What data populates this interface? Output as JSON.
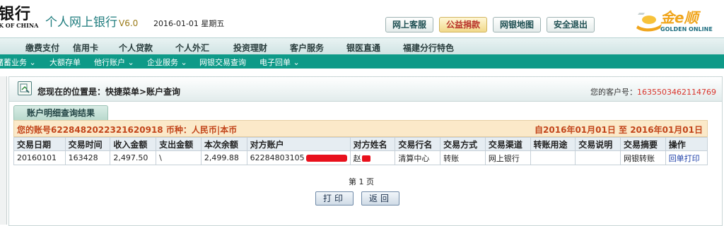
{
  "header": {
    "bank_name": "银行",
    "bank_sub": "K OF CHINA",
    "site_title": "个人网上银行",
    "version": "V6.0",
    "date": "2016-01-01 星期五",
    "buttons": [
      {
        "label": "网上客服",
        "color": "#1e4f52"
      },
      {
        "label": "公益捐款",
        "color": "#b8332a"
      },
      {
        "label": "网银地图",
        "color": "#1e4f52"
      },
      {
        "label": "安全退出",
        "color": "#1e4f52"
      }
    ],
    "golden_logo_cn": "金e顺",
    "golden_logo_en": "GOLDEN ONLINE"
  },
  "menu_primary": [
    "缴费支付",
    "信用卡",
    "个人贷款",
    "个人外汇",
    "投资理财",
    "客户服务",
    "银医直通",
    "福建分行特色"
  ],
  "menu_secondary": [
    "储蓄业务 ⌄",
    "大额存单",
    "他行账户 ⌄",
    "企业服务 ⌄",
    "网银交易查询",
    "电子回单 ⌄"
  ],
  "location": {
    "text": "您现在的位置是：快捷菜单>账户查询",
    "customer_label": "您的客户号：",
    "customer_no": "1635503462114769"
  },
  "tab_title": "账户明细查询结果",
  "summary": {
    "left": "您的账号6228482022321620918 币种：人民币|本币",
    "right": "自2016年01月01日 至 2016年01月01日"
  },
  "table": {
    "headers": [
      "交易日期",
      "交易时间",
      "收入金额",
      "支出金额",
      "本次余额",
      "对方账户",
      "对方姓名",
      "交易行名",
      "交易方式",
      "交易渠道",
      "转账用途",
      "交易说明",
      "交易摘要",
      "操作"
    ],
    "rows": [
      {
        "date": "20160101",
        "time": "163428",
        "income": "2,497.50",
        "expense": "\\",
        "balance": "2,499.88",
        "counter_account": "62284803105",
        "counter_name": "赵",
        "bank": "清算中心",
        "method": "转账",
        "channel": "网上银行",
        "purpose": "",
        "note": "",
        "summary": "网银转账",
        "action": "回单打印"
      }
    ]
  },
  "pagination": "第 1 页",
  "actions": {
    "print_label": "打印",
    "back_label": "返回"
  },
  "colors": {
    "accent_teal": "#0e9a88",
    "highlight_red": "#d9342b",
    "summary_bg": "#fbe9c9"
  }
}
